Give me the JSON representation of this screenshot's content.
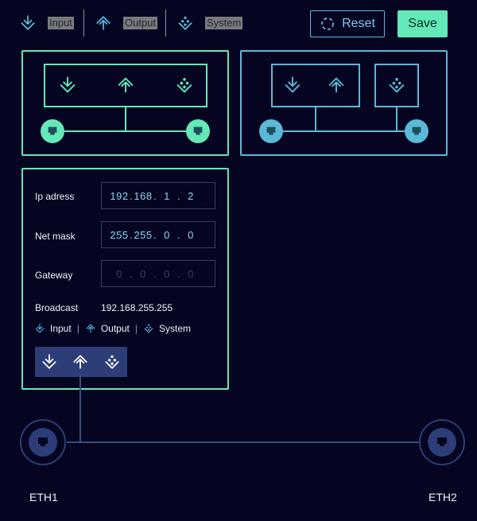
{
  "legend": {
    "input_label": "Input",
    "output_label": "Output",
    "system_label": "System"
  },
  "toolbar": {
    "reset_label": "Reset",
    "save_label": "Save"
  },
  "config": {
    "ip_label": "Ip adress",
    "ip_octets": [
      "192",
      "168",
      "1",
      "2"
    ],
    "mask_label": "Net mask",
    "mask_octets": [
      "255",
      "255",
      "0",
      "0"
    ],
    "gateway_label": "Gateway",
    "gateway_octets": [
      "0",
      "0",
      "0",
      "0"
    ],
    "broadcast_label": "Broadcast",
    "broadcast_value": "192.168.255.255",
    "legend_input": "Input",
    "legend_output": "Output",
    "legend_system": "System"
  },
  "ports": {
    "eth1_label": "ETH1",
    "eth2_label": "ETH2"
  },
  "colors": {
    "background": "#050521",
    "green_accent": "#63e8b8",
    "blue_accent": "#5ab9d9",
    "selected_bar": "#2c3d78"
  }
}
